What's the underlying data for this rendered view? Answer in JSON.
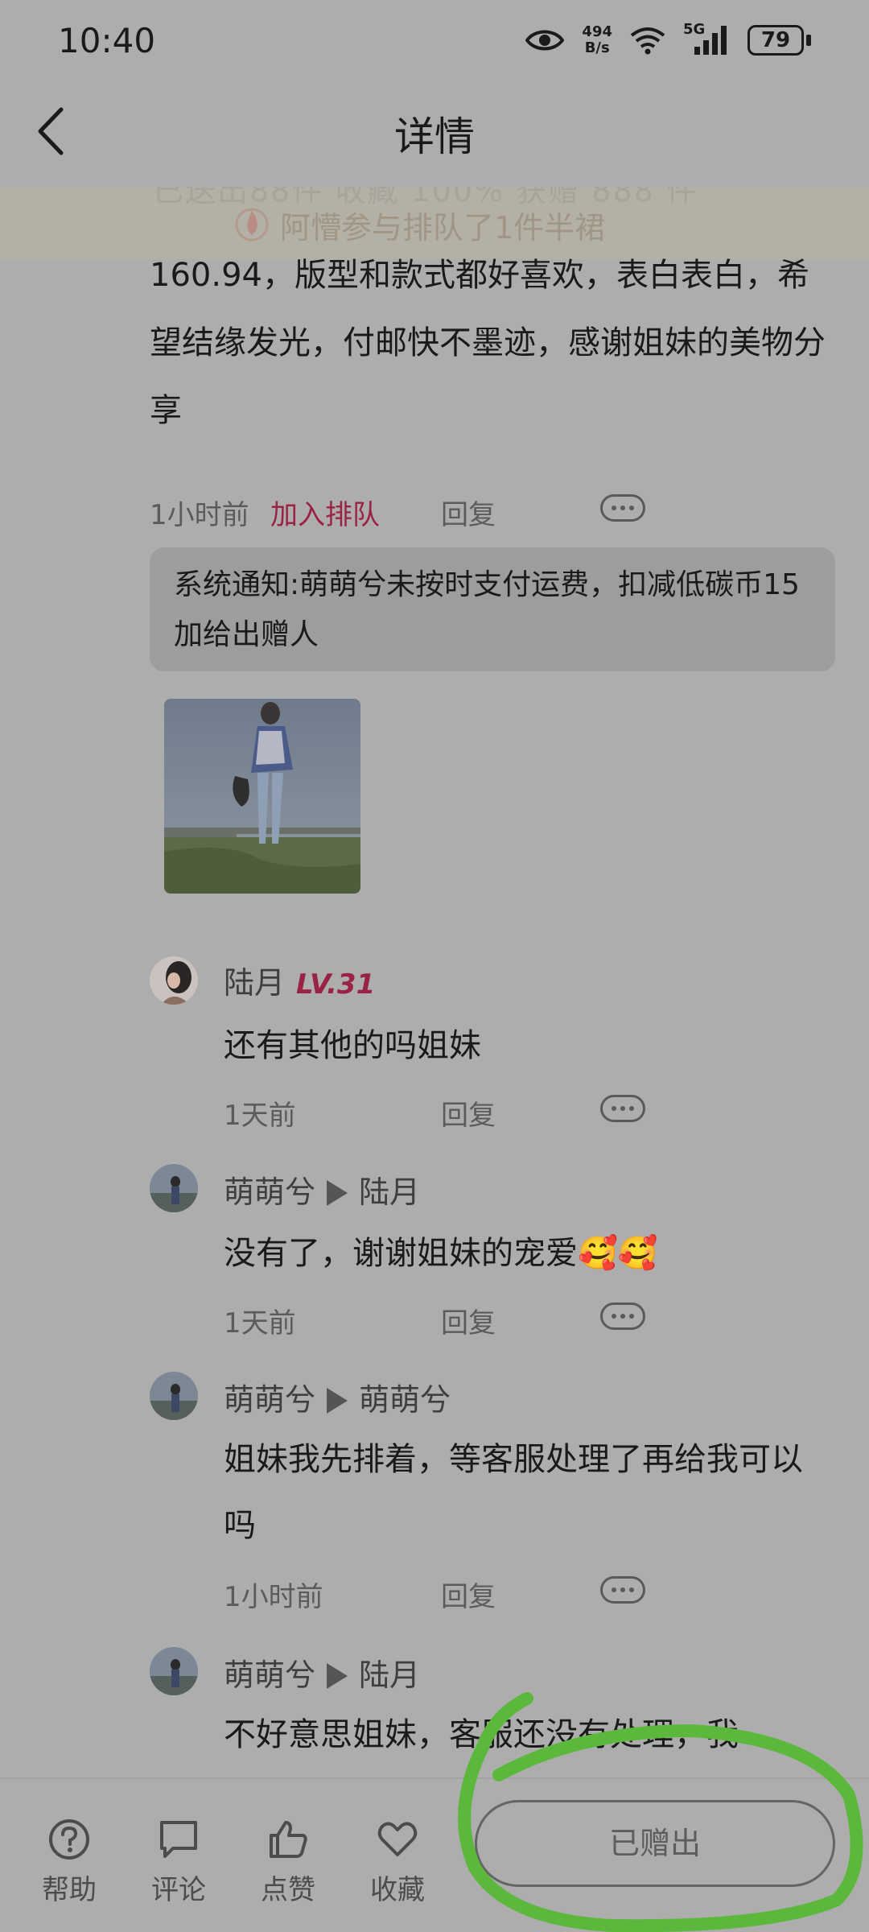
{
  "status_bar": {
    "time": "10:40",
    "net_speed_value": "494",
    "net_speed_unit": "B/s",
    "network": "5G",
    "battery": "79"
  },
  "nav": {
    "title": "详情"
  },
  "banner": {
    "ghost_text": "已送出88件    收藏 100%    获赠 888 件",
    "text": "阿懵参与排队了1件半裙"
  },
  "post": {
    "text": "160.94，版型和款式都好喜欢，表白表白，希望结缘发光，付邮快不墨迹，感谢姐妹的美物分享",
    "time": "1小时前",
    "join_queue": "加入排队",
    "reply": "回复"
  },
  "system_notice": "系统通知:萌萌兮未按时支付运费，扣减低碳币15加给出赠人",
  "comments": [
    {
      "name": "陆月",
      "level": "LV.31",
      "reply_to": "",
      "text": "还有其他的吗姐妹",
      "time": "1天前",
      "reply": "回复"
    },
    {
      "name": "萌萌兮",
      "level": "",
      "reply_to": "陆月",
      "text": "没有了，谢谢姐妹的宠爱🥰🥰",
      "time": "1天前",
      "reply": "回复"
    },
    {
      "name": "萌萌兮",
      "level": "",
      "reply_to": "萌萌兮",
      "text": "姐妹我先排着，等客服处理了再给我可以吗",
      "time": "1小时前",
      "reply": "回复"
    },
    {
      "name": "萌萌兮",
      "level": "",
      "reply_to": "陆月",
      "text": "不好意思姐妹，客服还没有处理，我",
      "time": "",
      "reply": ""
    }
  ],
  "bottom_bar": {
    "help": "帮助",
    "comment": "评论",
    "like": "点赞",
    "favorite": "收藏",
    "given_button": "已赠出"
  },
  "colors": {
    "background": "#adadad",
    "accent": "#9a2345",
    "annotation_green": "#5cb83c"
  }
}
